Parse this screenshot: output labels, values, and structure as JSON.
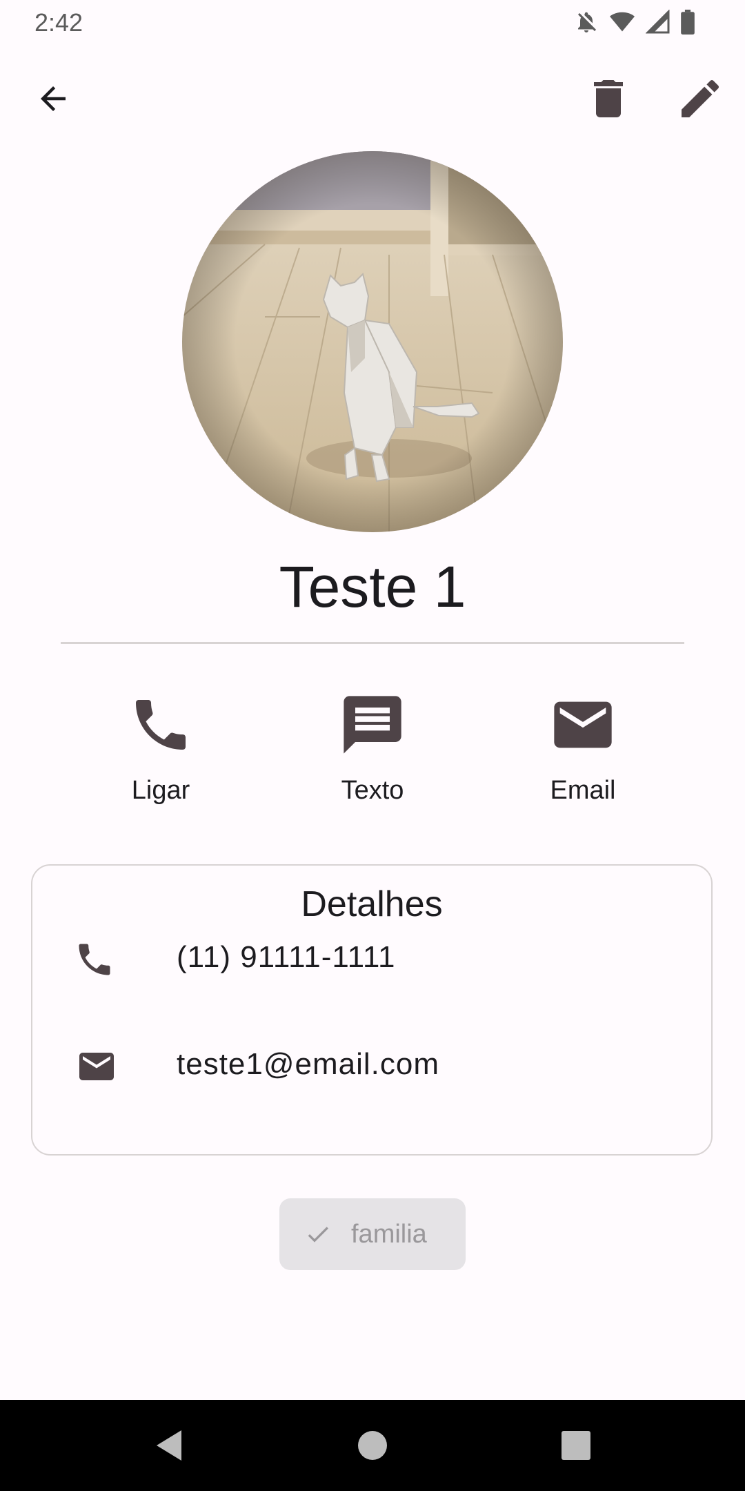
{
  "status_bar": {
    "time": "2:42",
    "icons": [
      "notifications-off-icon",
      "wifi-icon",
      "signal-icon",
      "battery-icon"
    ]
  },
  "app_bar": {
    "icons": [
      "back-arrow-icon",
      "delete-icon",
      "edit-icon"
    ]
  },
  "contact": {
    "name": "Teste 1",
    "photo": "origami-cat-photo"
  },
  "actions": [
    {
      "label": "Ligar",
      "icon": "phone-icon"
    },
    {
      "label": "Texto",
      "icon": "message-icon"
    },
    {
      "label": "Email",
      "icon": "email-icon"
    }
  ],
  "details": {
    "title": "Detalhes",
    "phone": "(11) 91111-1111",
    "email": "teste1@email.com"
  },
  "chip": {
    "label": "familia",
    "icon": "check-icon"
  },
  "colors": {
    "background": "#fffbfe",
    "icon": "#4e4347",
    "divider": "#d8d3d3",
    "chip_bg": "#e5e3e6",
    "chip_text": "#9a989b",
    "nav_bar": "#000000"
  }
}
